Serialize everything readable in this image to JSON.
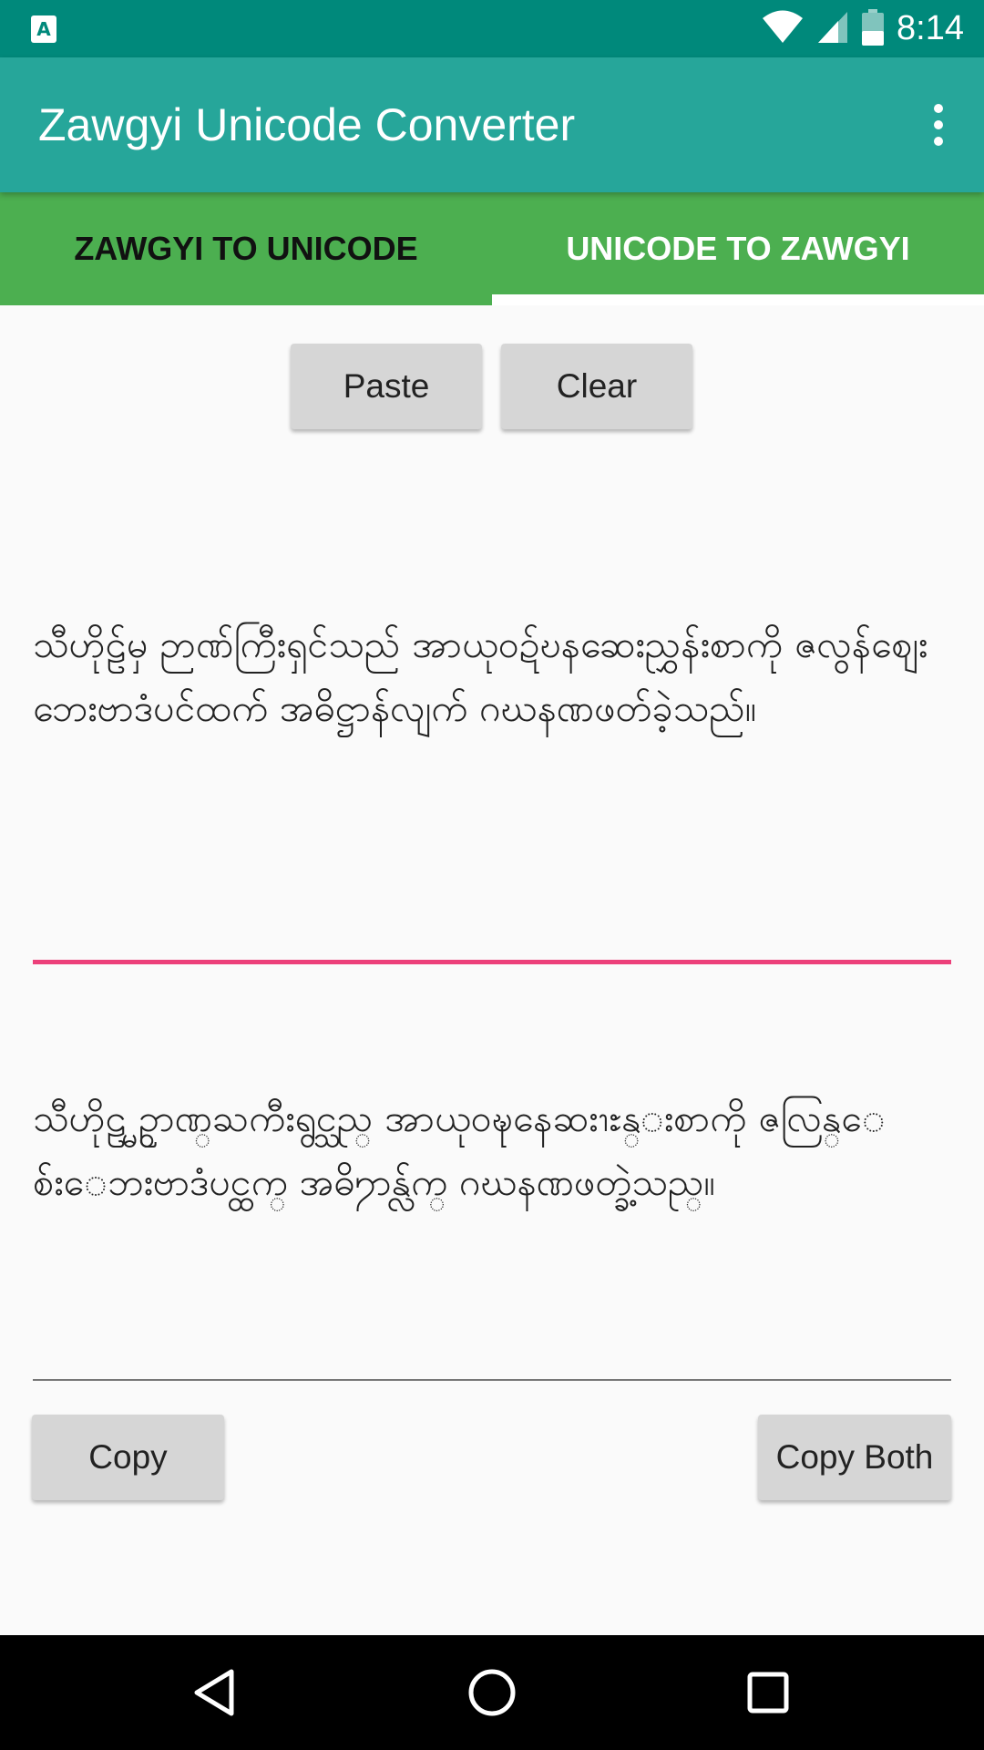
{
  "status_bar": {
    "notification_icon": "A",
    "time": "8:14",
    "icons": [
      "wifi-icon",
      "signal-icon",
      "battery-icon"
    ]
  },
  "app_bar": {
    "title": "Zawgyi Unicode Converter",
    "menu_icon": "more-vert-icon"
  },
  "tabs": [
    {
      "label": "ZAWGYI TO UNICODE",
      "selected": false
    },
    {
      "label": "UNICODE TO ZAWGYI",
      "selected": true
    }
  ],
  "toolbar": {
    "paste_label": "Paste",
    "clear_label": "Clear"
  },
  "input": {
    "text": "သီဟိုဠ်မှ ဉာဏ်ကြီးရှင်သည် အာယုဝဍ်ဎနဆေးညွှန်းစာကို ဇလွန်စျေးဘေးဗာဒံပင်ထက် အဓိဋ္ဌာန်လျက် ဂဃနဏဖတ်ခဲ့သည်။"
  },
  "output": {
    "text": "သီဟိုဠ္မွ ဥာဏ္ႀကီးရွင္သည္ အာယုဝဍ္ဎနေဆးၫႊန္းစာကို ဇလြန္ေစ်းေဘးဗာဒံပင္ထက္ အဓိ႒ာန္လ်က္ ဂဃနဏဖတ္ခဲ့သည္။"
  },
  "actions": {
    "copy_label": "Copy",
    "copy_both_label": "Copy Both"
  },
  "accent_colors": {
    "status_bar": "#00897b",
    "app_bar": "#26a69a",
    "tabs": "#4caf50",
    "focus_underline": "#ec407a"
  }
}
